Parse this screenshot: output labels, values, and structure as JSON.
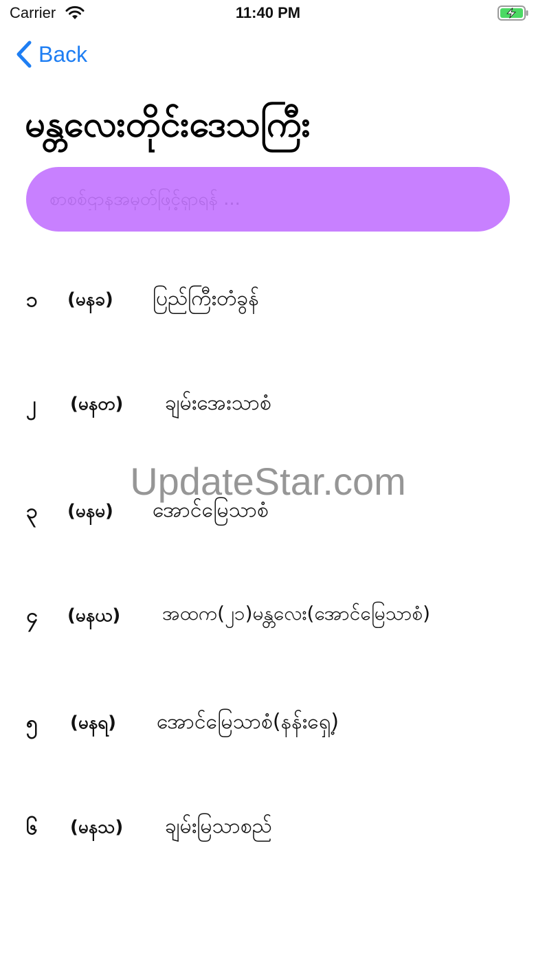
{
  "status_bar": {
    "carrier": "Carrier",
    "time": "11:40 PM",
    "wifi_icon": "wifi-icon",
    "battery_icon": "battery-charging-icon"
  },
  "nav": {
    "back_label": "Back",
    "back_icon": "chevron-left-icon"
  },
  "title": "မန္တလေးတိုင်းဒေသကြီး",
  "search": {
    "placeholder": "စာစစ်ဌာနအမှတ်ဖြင့်ရှာရန် ..."
  },
  "items": [
    {
      "num": "၁",
      "code": "(မနခ)",
      "name": "ပြည်ကြီးတံခွန်"
    },
    {
      "num": "၂",
      "code": "(မနတ)",
      "name": "ချမ်းအေးသာစံ"
    },
    {
      "num": "၃",
      "code": "(မနမ)",
      "name": "အောင်မြေသာစံ"
    },
    {
      "num": "၄",
      "code": "(မနယ)",
      "name": "အထက(၂၁)မန္တလေး(အောင်မြေသာစံ)"
    },
    {
      "num": "၅",
      "code": "(မနရ)",
      "name": "အောင်မြေသာစံ(နန်းရှေ့)"
    },
    {
      "num": "၆",
      "code": "(မနသ)",
      "name": "ချမ်းမြသာစည်"
    }
  ],
  "watermark": "UpdateStar.com",
  "colors": {
    "accent": "#1e7ef3",
    "search_bg": "#c880ff",
    "battery_green": "#4cd964"
  }
}
